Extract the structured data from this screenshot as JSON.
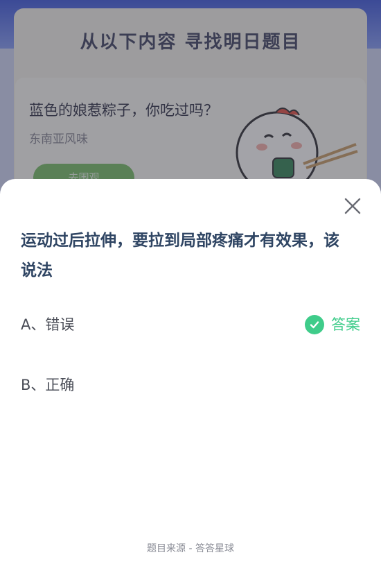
{
  "background": {
    "title": "从以下内容  寻找明日题目",
    "card": {
      "question": "蓝色的娘惹粽子，你吃过吗？",
      "subtitle": "东南亚风味",
      "button_label": "去围观"
    }
  },
  "sheet": {
    "question": "运动过后拉伸，要拉到局部疼痛才有效果，该说法",
    "options": [
      {
        "label": "A、错误",
        "is_answer": true
      },
      {
        "label": "B、正确",
        "is_answer": false
      }
    ],
    "answer_label": "答案",
    "footer": "题目来源 - 答答星球"
  },
  "colors": {
    "accent_green": "#3fcc8a",
    "question_text": "#2f4563"
  },
  "icons": {
    "close": "close-icon",
    "check": "check-circle-icon"
  }
}
